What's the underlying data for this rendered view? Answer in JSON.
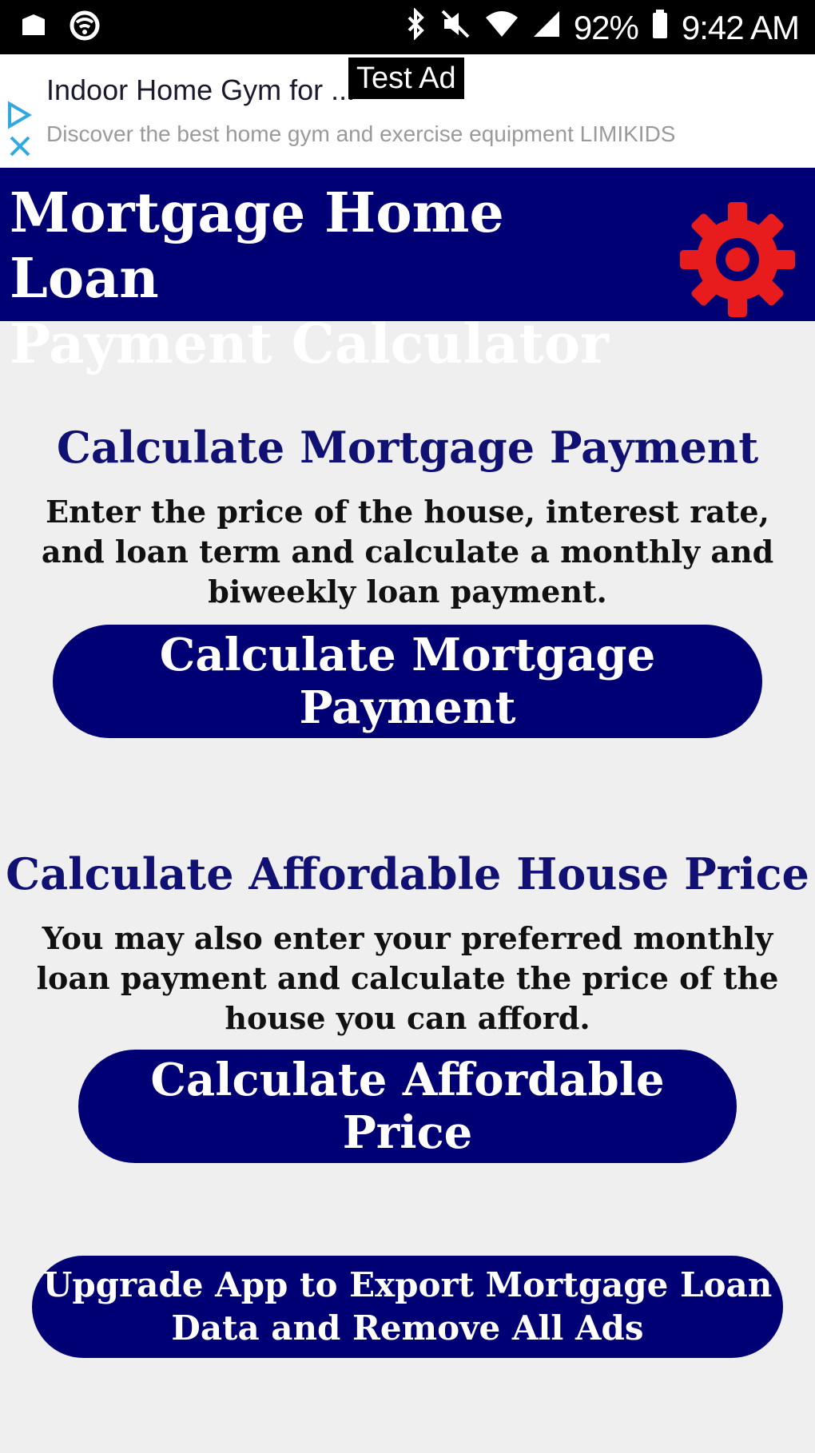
{
  "status_bar": {
    "battery_percent": "92%",
    "time": "9:42 AM",
    "icons": [
      "notification-icon",
      "wifi-icon",
      "bluetooth-icon",
      "mute-icon",
      "wifi-signal-icon",
      "cell-signal-icon",
      "battery-icon"
    ]
  },
  "ad": {
    "label": "Test Ad",
    "title": "Indoor Home Gym for ...",
    "description": "Discover the best home gym and exercise equipment LIMIKIDS"
  },
  "header": {
    "title_line1": "Mortgage Home Loan",
    "title_line2": "Payment Calculator",
    "settings_icon_color": "#e81c1c"
  },
  "mortgage": {
    "title": "Calculate Mortgage Payment",
    "description": "Enter the price of the house, interest rate, and loan term and calculate a monthly and biweekly loan payment.",
    "button": "Calculate Mortgage Payment"
  },
  "affordable": {
    "title": "Calculate Affordable House Price",
    "description": "You may also enter your preferred monthly loan payment and calculate the price of the house you can afford.",
    "button": "Calculate Affordable Price"
  },
  "upgrade": {
    "button_line1": "Upgrade App to Export Mortgage Loan",
    "button_line2": "Data and Remove All Ads"
  },
  "colors": {
    "primary": "#000074",
    "background": "#efefef",
    "accent": "#e81c1c"
  }
}
